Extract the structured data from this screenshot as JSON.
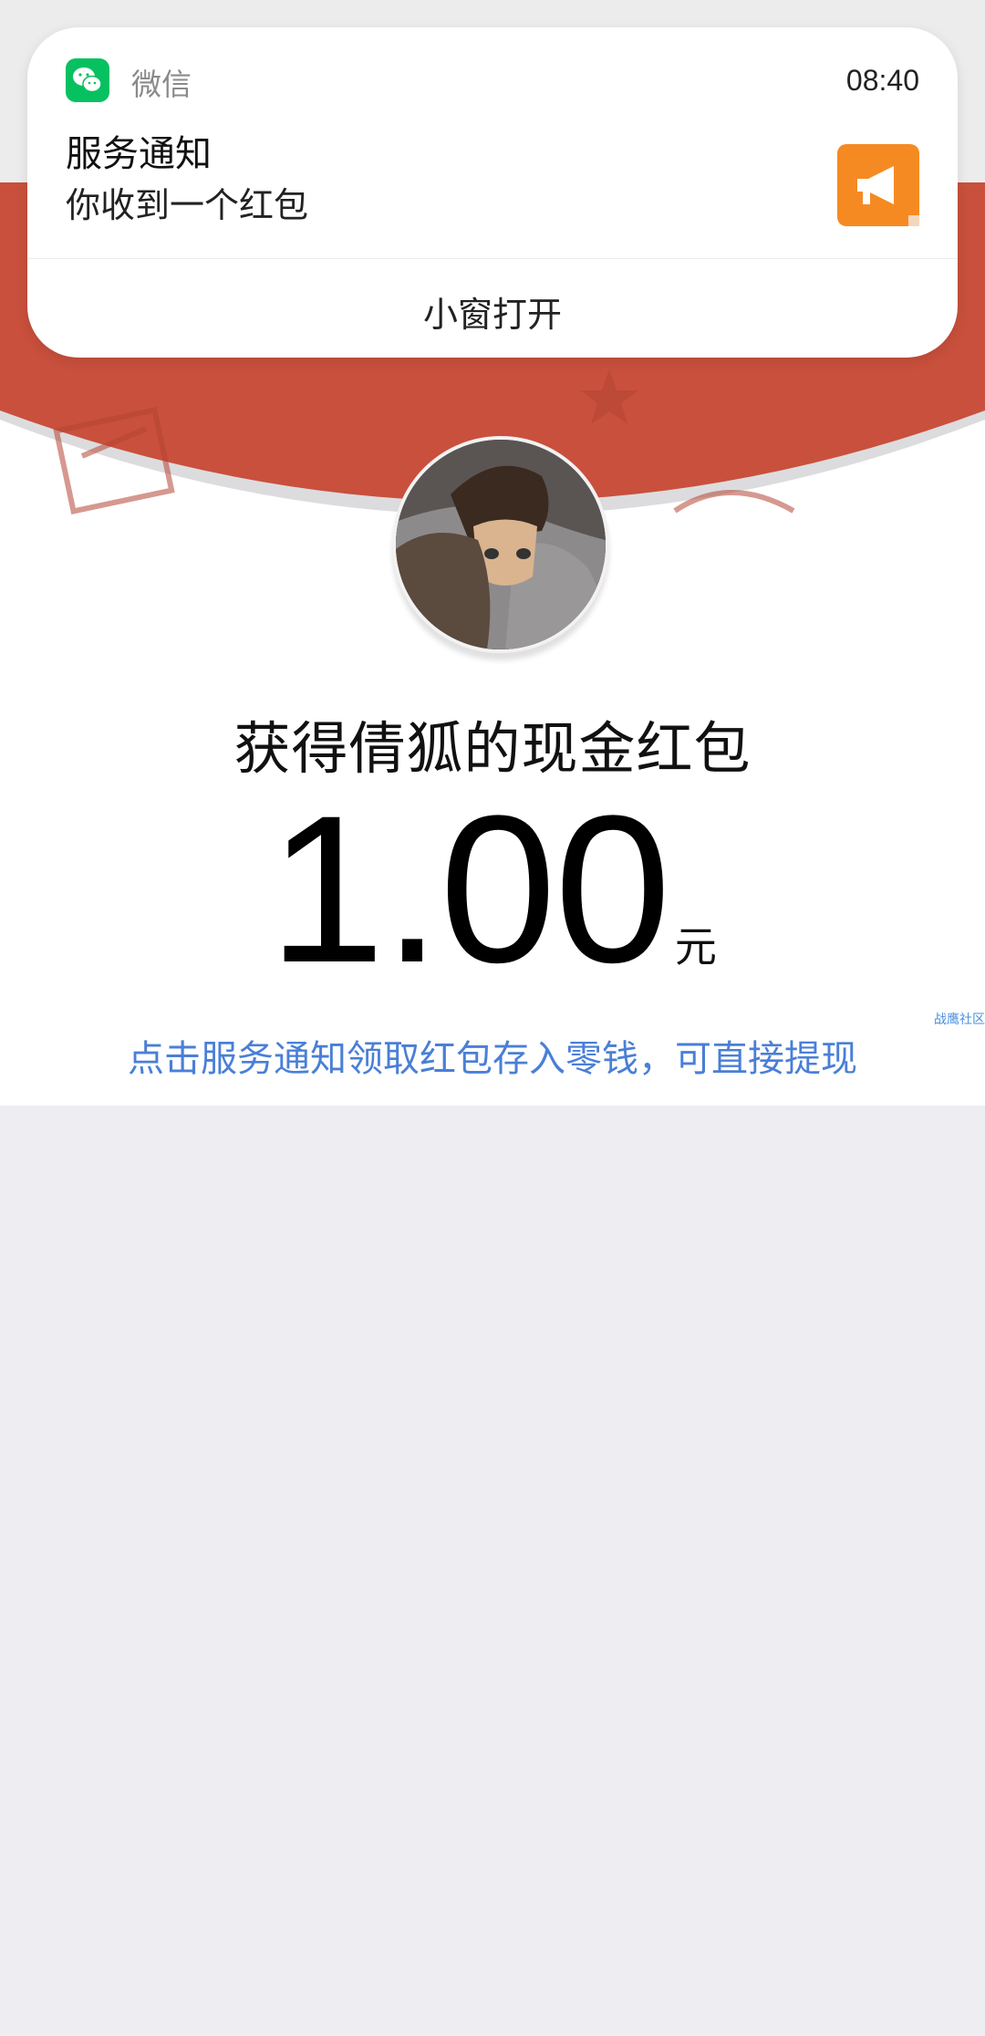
{
  "notification": {
    "app_name": "微信",
    "time": "08:40",
    "title": "服务通知",
    "body": "你收到一个红包",
    "action": "小窗打开"
  },
  "red_packet": {
    "title": "获得倩狐的现金红包",
    "amount": "1.00",
    "unit": "元",
    "hint": "点击服务通知领取红包存入零钱，可直接提现"
  },
  "watermark": "战鹰社区",
  "colors": {
    "red": "#c9503c",
    "wechat_green": "#07c160",
    "link_blue": "#4a7fd6",
    "thumb_orange": "#f58a23"
  },
  "icons": {
    "app": "wechat-icon",
    "thumb": "megaphone-icon"
  }
}
